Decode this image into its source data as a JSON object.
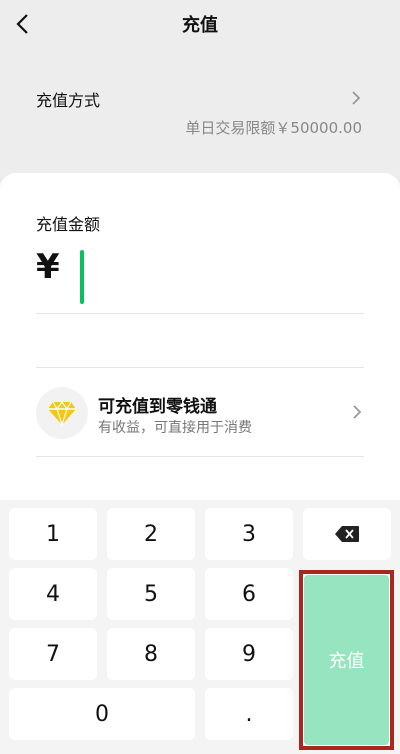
{
  "header": {
    "title": "充值"
  },
  "method": {
    "label": "充值方式",
    "limit": "单日交易限额￥50000.00"
  },
  "amount": {
    "label": "充值金额",
    "currency": "¥",
    "value": ""
  },
  "wallet": {
    "title": "可充值到零钱通",
    "subtitle": "有收益，可直接用于消费"
  },
  "keypad": {
    "keys": [
      "1",
      "2",
      "3",
      "4",
      "5",
      "6",
      "7",
      "8",
      "9",
      "0",
      "."
    ],
    "recharge_label": "充值"
  },
  "colors": {
    "accent": "#07c160",
    "recharge_button": "#97e4c0",
    "highlight_border": "#a8271f"
  }
}
